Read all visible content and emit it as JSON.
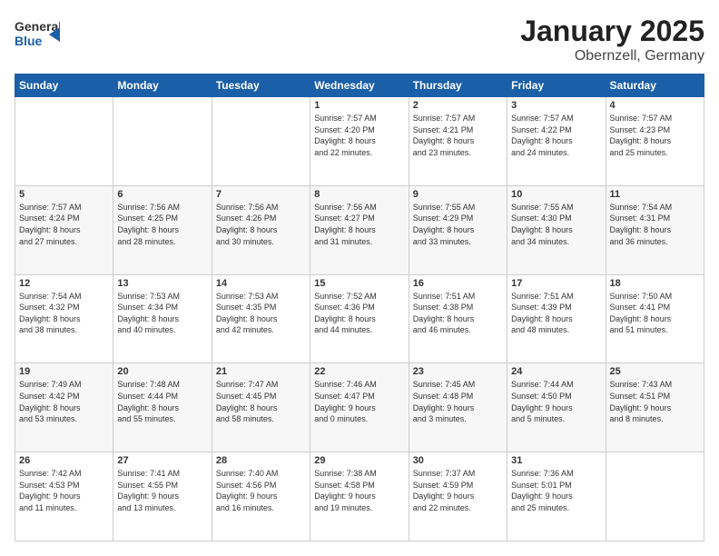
{
  "logo": {
    "general": "General",
    "blue": "Blue"
  },
  "title": "January 2025",
  "location": "Obernzell, Germany",
  "weekdays": [
    "Sunday",
    "Monday",
    "Tuesday",
    "Wednesday",
    "Thursday",
    "Friday",
    "Saturday"
  ],
  "weeks": [
    [
      {
        "day": "",
        "info": ""
      },
      {
        "day": "",
        "info": ""
      },
      {
        "day": "",
        "info": ""
      },
      {
        "day": "1",
        "info": "Sunrise: 7:57 AM\nSunset: 4:20 PM\nDaylight: 8 hours\nand 22 minutes."
      },
      {
        "day": "2",
        "info": "Sunrise: 7:57 AM\nSunset: 4:21 PM\nDaylight: 8 hours\nand 23 minutes."
      },
      {
        "day": "3",
        "info": "Sunrise: 7:57 AM\nSunset: 4:22 PM\nDaylight: 8 hours\nand 24 minutes."
      },
      {
        "day": "4",
        "info": "Sunrise: 7:57 AM\nSunset: 4:23 PM\nDaylight: 8 hours\nand 25 minutes."
      }
    ],
    [
      {
        "day": "5",
        "info": "Sunrise: 7:57 AM\nSunset: 4:24 PM\nDaylight: 8 hours\nand 27 minutes."
      },
      {
        "day": "6",
        "info": "Sunrise: 7:56 AM\nSunset: 4:25 PM\nDaylight: 8 hours\nand 28 minutes."
      },
      {
        "day": "7",
        "info": "Sunrise: 7:56 AM\nSunset: 4:26 PM\nDaylight: 8 hours\nand 30 minutes."
      },
      {
        "day": "8",
        "info": "Sunrise: 7:56 AM\nSunset: 4:27 PM\nDaylight: 8 hours\nand 31 minutes."
      },
      {
        "day": "9",
        "info": "Sunrise: 7:55 AM\nSunset: 4:29 PM\nDaylight: 8 hours\nand 33 minutes."
      },
      {
        "day": "10",
        "info": "Sunrise: 7:55 AM\nSunset: 4:30 PM\nDaylight: 8 hours\nand 34 minutes."
      },
      {
        "day": "11",
        "info": "Sunrise: 7:54 AM\nSunset: 4:31 PM\nDaylight: 8 hours\nand 36 minutes."
      }
    ],
    [
      {
        "day": "12",
        "info": "Sunrise: 7:54 AM\nSunset: 4:32 PM\nDaylight: 8 hours\nand 38 minutes."
      },
      {
        "day": "13",
        "info": "Sunrise: 7:53 AM\nSunset: 4:34 PM\nDaylight: 8 hours\nand 40 minutes."
      },
      {
        "day": "14",
        "info": "Sunrise: 7:53 AM\nSunset: 4:35 PM\nDaylight: 8 hours\nand 42 minutes."
      },
      {
        "day": "15",
        "info": "Sunrise: 7:52 AM\nSunset: 4:36 PM\nDaylight: 8 hours\nand 44 minutes."
      },
      {
        "day": "16",
        "info": "Sunrise: 7:51 AM\nSunset: 4:38 PM\nDaylight: 8 hours\nand 46 minutes."
      },
      {
        "day": "17",
        "info": "Sunrise: 7:51 AM\nSunset: 4:39 PM\nDaylight: 8 hours\nand 48 minutes."
      },
      {
        "day": "18",
        "info": "Sunrise: 7:50 AM\nSunset: 4:41 PM\nDaylight: 8 hours\nand 51 minutes."
      }
    ],
    [
      {
        "day": "19",
        "info": "Sunrise: 7:49 AM\nSunset: 4:42 PM\nDaylight: 8 hours\nand 53 minutes."
      },
      {
        "day": "20",
        "info": "Sunrise: 7:48 AM\nSunset: 4:44 PM\nDaylight: 8 hours\nand 55 minutes."
      },
      {
        "day": "21",
        "info": "Sunrise: 7:47 AM\nSunset: 4:45 PM\nDaylight: 8 hours\nand 58 minutes."
      },
      {
        "day": "22",
        "info": "Sunrise: 7:46 AM\nSunset: 4:47 PM\nDaylight: 9 hours\nand 0 minutes."
      },
      {
        "day": "23",
        "info": "Sunrise: 7:45 AM\nSunset: 4:48 PM\nDaylight: 9 hours\nand 3 minutes."
      },
      {
        "day": "24",
        "info": "Sunrise: 7:44 AM\nSunset: 4:50 PM\nDaylight: 9 hours\nand 5 minutes."
      },
      {
        "day": "25",
        "info": "Sunrise: 7:43 AM\nSunset: 4:51 PM\nDaylight: 9 hours\nand 8 minutes."
      }
    ],
    [
      {
        "day": "26",
        "info": "Sunrise: 7:42 AM\nSunset: 4:53 PM\nDaylight: 9 hours\nand 11 minutes."
      },
      {
        "day": "27",
        "info": "Sunrise: 7:41 AM\nSunset: 4:55 PM\nDaylight: 9 hours\nand 13 minutes."
      },
      {
        "day": "28",
        "info": "Sunrise: 7:40 AM\nSunset: 4:56 PM\nDaylight: 9 hours\nand 16 minutes."
      },
      {
        "day": "29",
        "info": "Sunrise: 7:38 AM\nSunset: 4:58 PM\nDaylight: 9 hours\nand 19 minutes."
      },
      {
        "day": "30",
        "info": "Sunrise: 7:37 AM\nSunset: 4:59 PM\nDaylight: 9 hours\nand 22 minutes."
      },
      {
        "day": "31",
        "info": "Sunrise: 7:36 AM\nSunset: 5:01 PM\nDaylight: 9 hours\nand 25 minutes."
      },
      {
        "day": "",
        "info": ""
      }
    ]
  ]
}
